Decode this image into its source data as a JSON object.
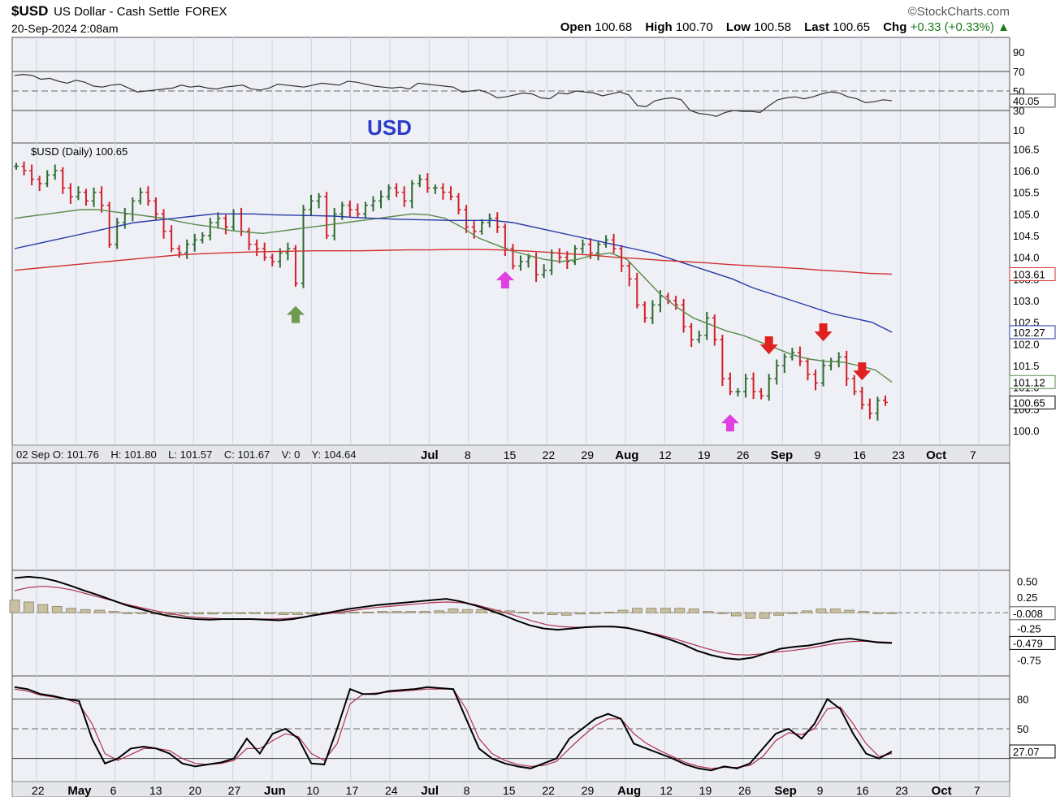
{
  "header": {
    "symbol": "$USD",
    "name": "US Dollar - Cash Settle",
    "exchange": "FOREX",
    "timestamp": "20-Sep-2024 2:08am",
    "brand": "©StockCharts.com",
    "quote": {
      "open_label": "Open",
      "open": "100.68",
      "high_label": "High",
      "high": "100.70",
      "low_label": "Low",
      "low": "100.58",
      "last_label": "Last",
      "last": "100.65",
      "chg_label": "Chg",
      "chg": "+0.33 (+0.33%)"
    }
  },
  "panels": {
    "price_label": "$USD (Daily) 100.65",
    "annotation": "USD",
    "info_bar": "02 Sep O: 101.76    H: 101.80    L: 101.57    C: 101.67    V: 0    Y: 104.64"
  },
  "chart_data": [
    {
      "type": "line",
      "panel": "rsi",
      "ylim": [
        0,
        100
      ],
      "ticks": [
        "90",
        "70",
        "50",
        "30",
        "10"
      ],
      "last_value_label": "40.05",
      "series": [
        {
          "values": [
            66,
            67,
            66,
            62,
            63,
            60,
            58,
            61,
            59,
            55,
            54,
            56,
            57,
            53,
            49,
            50,
            51,
            52,
            53,
            56,
            54,
            55,
            53,
            52,
            54,
            55,
            56,
            52,
            51,
            53,
            57,
            56,
            55,
            54,
            56,
            58,
            57,
            56,
            60,
            59,
            57,
            55,
            54,
            53,
            54,
            52,
            58,
            57,
            56,
            55,
            54,
            49,
            50,
            51,
            48,
            43,
            44,
            46,
            48,
            47,
            43,
            42,
            48,
            47,
            50,
            49,
            48,
            45,
            47,
            49,
            46,
            35,
            34,
            40,
            42,
            43,
            41,
            30,
            27,
            26,
            24,
            28,
            30,
            29,
            29,
            28,
            35,
            41,
            43,
            44,
            42,
            44,
            47,
            49,
            48,
            44,
            42,
            38,
            39,
            41,
            40.05
          ]
        }
      ]
    },
    {
      "type": "ohlc",
      "panel": "price",
      "ylim": [
        99.7,
        106.6
      ],
      "ticks": [
        "106.5",
        "106.0",
        "105.5",
        "105.0",
        "104.5",
        "104.0",
        "103.5",
        "103.0",
        "102.5",
        "102.0",
        "101.5",
        "101.0",
        "100.5",
        "100.0"
      ],
      "value_labels": [
        "103.61",
        "102.27",
        "101.12",
        "100.65"
      ],
      "x_ticks": [
        "Jul",
        "8",
        "15",
        "22",
        "29",
        "Aug",
        "12",
        "19",
        "26",
        "Sep",
        "9",
        "16",
        "23",
        "Oct",
        "7"
      ],
      "closes": [
        106.1,
        106.0,
        105.8,
        105.7,
        105.9,
        106.0,
        105.6,
        105.4,
        105.5,
        105.3,
        105.5,
        105.2,
        104.3,
        104.8,
        105.0,
        105.3,
        105.5,
        105.3,
        105.0,
        104.6,
        104.2,
        104.1,
        104.3,
        104.4,
        104.5,
        104.8,
        104.9,
        104.7,
        105.0,
        104.6,
        104.3,
        104.2,
        104.0,
        103.9,
        104.1,
        104.2,
        103.4,
        105.1,
        105.3,
        105.4,
        104.5,
        105.0,
        105.2,
        105.1,
        105.0,
        105.2,
        105.3,
        105.4,
        105.6,
        105.5,
        105.3,
        105.7,
        105.8,
        105.6,
        105.6,
        105.5,
        105.4,
        105.1,
        104.7,
        104.6,
        104.8,
        104.9,
        104.7,
        104.2,
        103.8,
        103.9,
        104.0,
        103.6,
        103.7,
        104.1,
        104.0,
        103.9,
        104.2,
        104.3,
        104.1,
        104.3,
        104.4,
        104.2,
        103.8,
        103.5,
        102.9,
        102.6,
        102.9,
        103.1,
        103.0,
        102.9,
        102.4,
        102.1,
        102.2,
        102.6,
        102.1,
        101.2,
        100.9,
        100.9,
        101.2,
        100.9,
        100.8,
        101.2,
        101.5,
        101.7,
        101.8,
        101.6,
        101.3,
        101.1,
        101.5,
        101.6,
        101.7,
        101.2,
        100.9,
        100.6,
        100.4,
        100.7,
        100.65
      ],
      "series": [
        {
          "values": [
            104.9,
            104.95,
            105.0,
            105.05,
            105.1,
            105.1,
            105.05,
            105.0,
            104.95,
            104.9,
            104.82,
            104.75,
            104.7,
            104.62,
            104.58,
            104.55,
            104.6,
            104.65,
            104.7,
            104.75,
            104.8,
            104.85,
            104.9,
            104.95,
            105.0,
            104.98,
            104.9,
            104.7,
            104.45,
            104.3,
            104.15,
            104.05,
            103.95,
            103.9,
            103.95,
            104.05,
            104.1,
            103.95,
            103.55,
            103.15,
            102.85,
            102.6,
            102.45,
            102.3,
            102.2,
            102.05,
            101.9,
            101.75,
            101.65,
            101.6,
            101.58,
            101.5,
            101.4,
            101.12
          ]
        },
        {
          "values": [
            104.2,
            104.3,
            104.4,
            104.5,
            104.6,
            104.7,
            104.8,
            104.85,
            104.9,
            104.95,
            105.0,
            105.0,
            105.0,
            104.98,
            104.97,
            104.96,
            104.95,
            104.92,
            104.9,
            104.88,
            104.87,
            104.86,
            104.85,
            104.85,
            104.85,
            104.8,
            104.7,
            104.6,
            104.5,
            104.4,
            104.3,
            104.2,
            104.1,
            103.95,
            103.8,
            103.65,
            103.5,
            103.3,
            103.15,
            103.0,
            102.85,
            102.7,
            102.6,
            102.5,
            102.27
          ]
        },
        {
          "values": [
            103.7,
            103.75,
            103.8,
            103.85,
            103.9,
            103.95,
            104.0,
            104.05,
            104.08,
            104.1,
            104.12,
            104.13,
            104.14,
            104.15,
            104.15,
            104.15,
            104.16,
            104.17,
            104.17,
            104.18,
            104.18,
            104.17,
            104.15,
            104.12,
            104.08,
            104.05,
            104.0,
            103.97,
            103.93,
            103.9,
            103.87,
            103.83,
            103.8,
            103.77,
            103.74,
            103.7,
            103.67,
            103.63,
            103.61
          ]
        }
      ],
      "annotations": [
        {
          "shape": "up-arrow",
          "color": "#6f9a4f",
          "index": 36
        },
        {
          "shape": "up-arrow",
          "color": "#e040e0",
          "index": 63
        },
        {
          "shape": "up-arrow",
          "color": "#e040e0",
          "index": 92
        },
        {
          "shape": "down-arrow",
          "color": "#e02020",
          "index": 97
        },
        {
          "shape": "down-arrow",
          "color": "#e02020",
          "index": 104
        },
        {
          "shape": "down-arrow",
          "color": "#e02020",
          "index": 109
        }
      ]
    },
    {
      "type": "line",
      "panel": "macd",
      "ylim": [
        -0.95,
        0.62
      ],
      "ticks": [
        "0.50",
        "0.25",
        "-0.25",
        "-0.50",
        "-0.75"
      ],
      "value_labels": [
        "-0.008",
        "-0.479"
      ],
      "series": [
        {
          "values": [
            0.55,
            0.57,
            0.55,
            0.5,
            0.43,
            0.35,
            0.28,
            0.2,
            0.12,
            0.06,
            0.0,
            -0.05,
            -0.08,
            -0.1,
            -0.11,
            -0.1,
            -0.1,
            -0.1,
            -0.11,
            -0.12,
            -0.1,
            -0.06,
            -0.02,
            0.02,
            0.06,
            0.09,
            0.12,
            0.14,
            0.16,
            0.18,
            0.2,
            0.22,
            0.18,
            0.12,
            0.05,
            -0.03,
            -0.12,
            -0.2,
            -0.25,
            -0.27,
            -0.25,
            -0.23,
            -0.22,
            -0.22,
            -0.24,
            -0.29,
            -0.35,
            -0.42,
            -0.5,
            -0.6,
            -0.67,
            -0.72,
            -0.74,
            -0.71,
            -0.64,
            -0.57,
            -0.54,
            -0.52,
            -0.48,
            -0.43,
            -0.41,
            -0.44,
            -0.47,
            -0.479
          ]
        },
        {
          "values": [
            0.35,
            0.4,
            0.42,
            0.4,
            0.36,
            0.3,
            0.24,
            0.18,
            0.12,
            0.07,
            0.02,
            -0.02,
            -0.06,
            -0.08,
            -0.09,
            -0.1,
            -0.1,
            -0.1,
            -0.1,
            -0.09,
            -0.07,
            -0.04,
            -0.01,
            0.02,
            0.05,
            0.08,
            0.1,
            0.12,
            0.14,
            0.16,
            0.17,
            0.16,
            0.13,
            0.07,
            0.01,
            -0.06,
            -0.13,
            -0.19,
            -0.22,
            -0.23,
            -0.23,
            -0.22,
            -0.23,
            -0.26,
            -0.31,
            -0.36,
            -0.42,
            -0.49,
            -0.56,
            -0.62,
            -0.66,
            -0.67,
            -0.65,
            -0.62,
            -0.6,
            -0.57,
            -0.53,
            -0.49,
            -0.46,
            -0.45,
            -0.46,
            -0.47
          ]
        }
      ],
      "histogram": [
        0.2,
        0.17,
        0.13,
        0.1,
        0.07,
        0.05,
        0.04,
        0.02,
        0.0,
        -0.01,
        -0.02,
        -0.03,
        -0.02,
        -0.02,
        -0.02,
        0.0,
        0.0,
        0.0,
        -0.01,
        -0.03,
        -0.03,
        -0.02,
        -0.01,
        0.0,
        0.01,
        0.01,
        0.02,
        0.02,
        0.02,
        0.02,
        0.03,
        0.06,
        0.05,
        0.05,
        0.04,
        0.03,
        0.01,
        -0.01,
        -0.03,
        -0.04,
        -0.02,
        -0.01,
        0.01,
        0.04,
        0.07,
        0.07,
        0.07,
        0.07,
        0.06,
        0.02,
        -0.01,
        -0.05,
        -0.09,
        -0.09,
        -0.04,
        0.0,
        0.03,
        0.06,
        0.06,
        0.04,
        0.02,
        0.0,
        -0.008
      ]
    },
    {
      "type": "line",
      "panel": "stochastic",
      "ylim": [
        0,
        100
      ],
      "ticks": [
        "80",
        "50",
        "27.07"
      ],
      "x_ticks": [
        "22",
        "May",
        "6",
        "13",
        "20",
        "27",
        "Jun",
        "10",
        "17",
        "24",
        "Jul",
        "8",
        "15",
        "22",
        "29",
        "Aug",
        "12",
        "19",
        "26",
        "Sep",
        "9",
        "16",
        "23",
        "Oct",
        "7"
      ],
      "series": [
        {
          "values": [
            92,
            90,
            85,
            83,
            80,
            78,
            40,
            15,
            20,
            30,
            32,
            30,
            25,
            15,
            12,
            14,
            16,
            20,
            40,
            25,
            45,
            50,
            40,
            15,
            14,
            50,
            90,
            85,
            85,
            88,
            89,
            90,
            92,
            91,
            90,
            60,
            30,
            20,
            15,
            12,
            10,
            15,
            20,
            40,
            50,
            60,
            65,
            60,
            35,
            30,
            25,
            20,
            14,
            10,
            8,
            12,
            10,
            15,
            30,
            45,
            50,
            40,
            55,
            80,
            70,
            45,
            25,
            20,
            27.07
          ]
        },
        {
          "values": [
            90,
            88,
            84,
            82,
            80,
            75,
            55,
            25,
            18,
            24,
            30,
            30,
            28,
            20,
            15,
            14,
            15,
            18,
            30,
            30,
            38,
            45,
            42,
            25,
            18,
            35,
            75,
            85,
            86,
            87,
            88,
            89,
            90,
            90,
            90,
            70,
            40,
            25,
            18,
            14,
            12,
            13,
            17,
            30,
            42,
            53,
            60,
            60,
            45,
            35,
            28,
            22,
            16,
            12,
            10,
            11,
            11,
            13,
            22,
            38,
            46,
            44,
            50,
            70,
            72,
            55,
            35,
            22,
            25
          ]
        }
      ]
    }
  ]
}
